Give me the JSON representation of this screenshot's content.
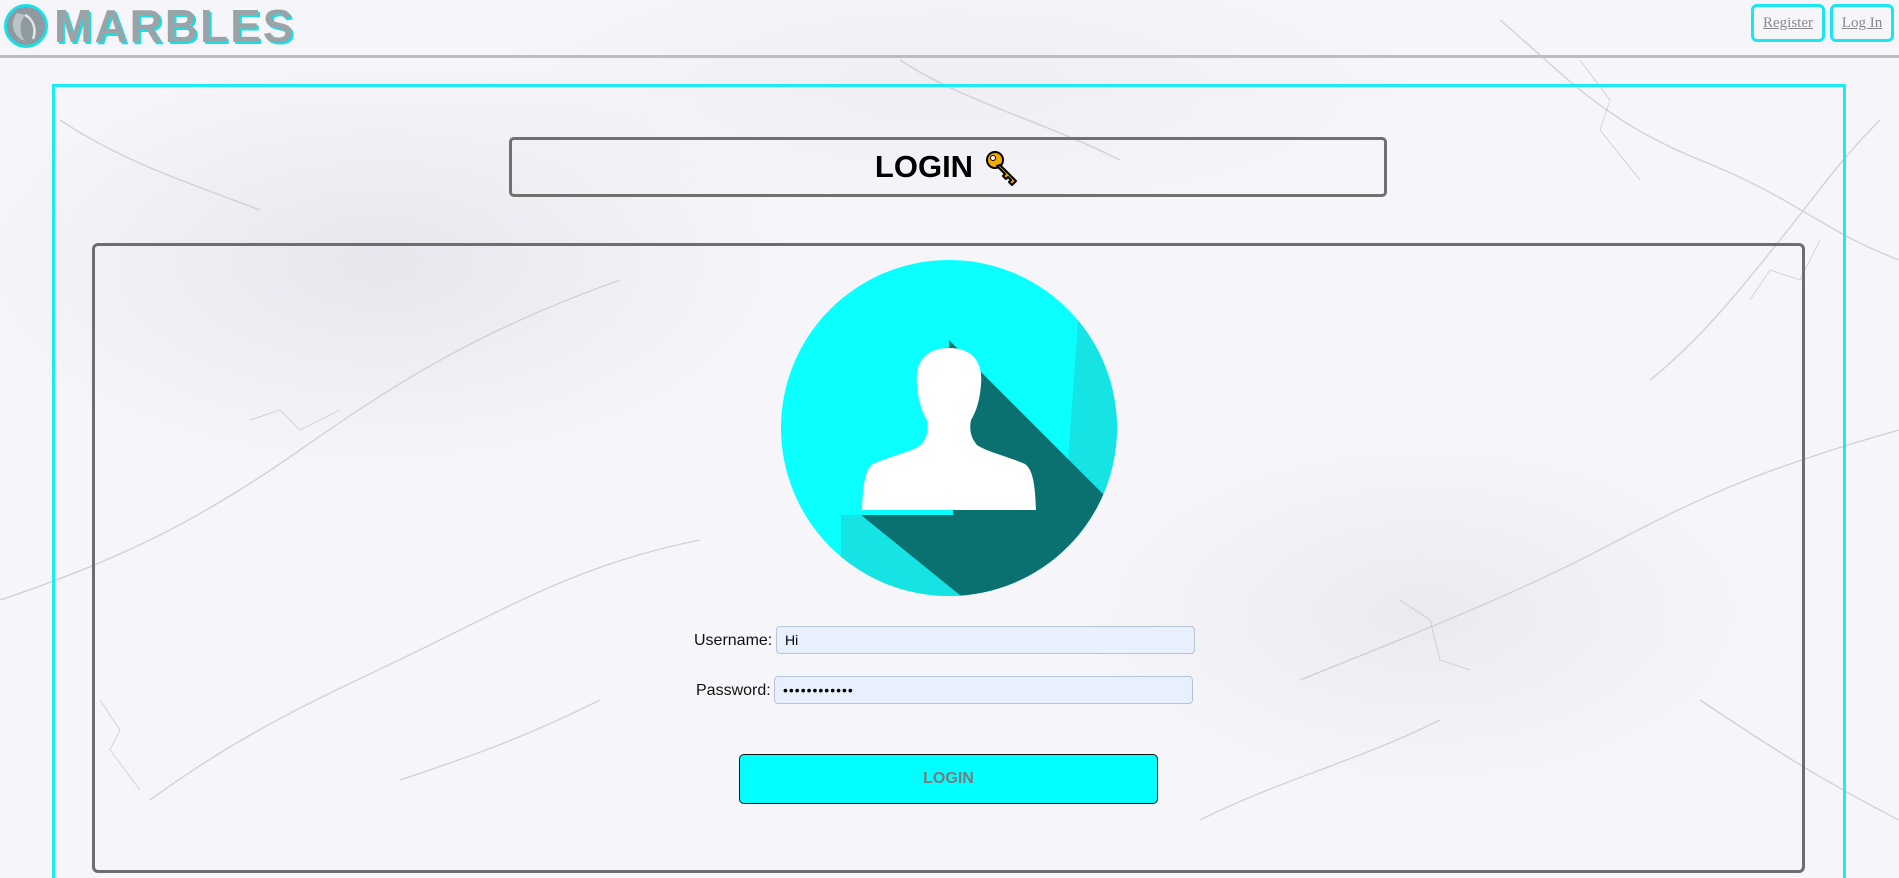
{
  "brand": {
    "name": "MARBLES",
    "logo_icon": "marbles-leaf-icon",
    "accent_color": "#19e6f0",
    "text_color": "#9aa4a8"
  },
  "nav": {
    "register_label": "Register",
    "login_label": "Log In"
  },
  "page": {
    "title": "LOGIN",
    "title_icon": "key-icon"
  },
  "avatar": {
    "icon": "user-avatar-icon",
    "bg_color": "#0affff",
    "shadow_color": "#0b7170"
  },
  "form": {
    "username_label": "Username:",
    "username_value": "Hi",
    "password_label": "Password:",
    "password_value": "••••••••••••",
    "field_bg": "#e8f0fe",
    "submit_label": "LOGIN",
    "submit_bg": "#00ffff"
  }
}
